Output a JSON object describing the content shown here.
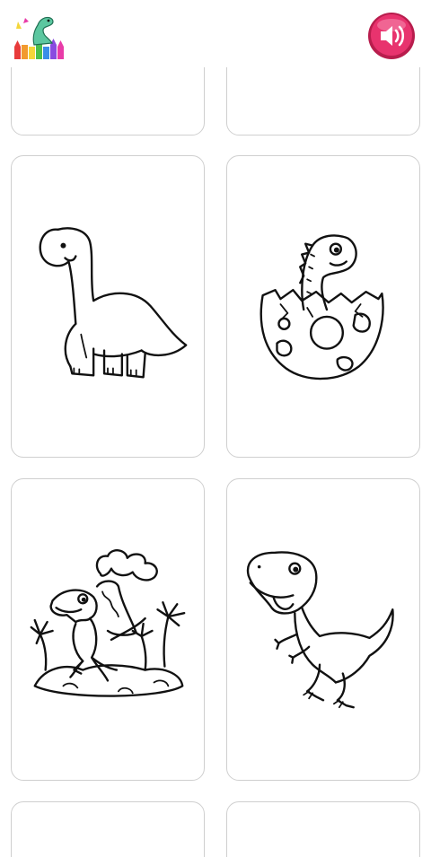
{
  "app": {
    "logo_icon": "dinosaur-crayons-logo",
    "sound_icon": "speaker-sound-icon",
    "sound_button_color": "#e8336e"
  },
  "cards": [
    {
      "subject": "blank-page"
    },
    {
      "subject": "blank-page"
    },
    {
      "subject": "long-neck-dinosaur"
    },
    {
      "subject": "baby-dinosaur-hatching-egg"
    },
    {
      "subject": "dinosaur-with-volcano"
    },
    {
      "subject": "t-rex-dinosaur"
    },
    {
      "subject": "blank-page"
    },
    {
      "subject": "blank-page"
    }
  ]
}
